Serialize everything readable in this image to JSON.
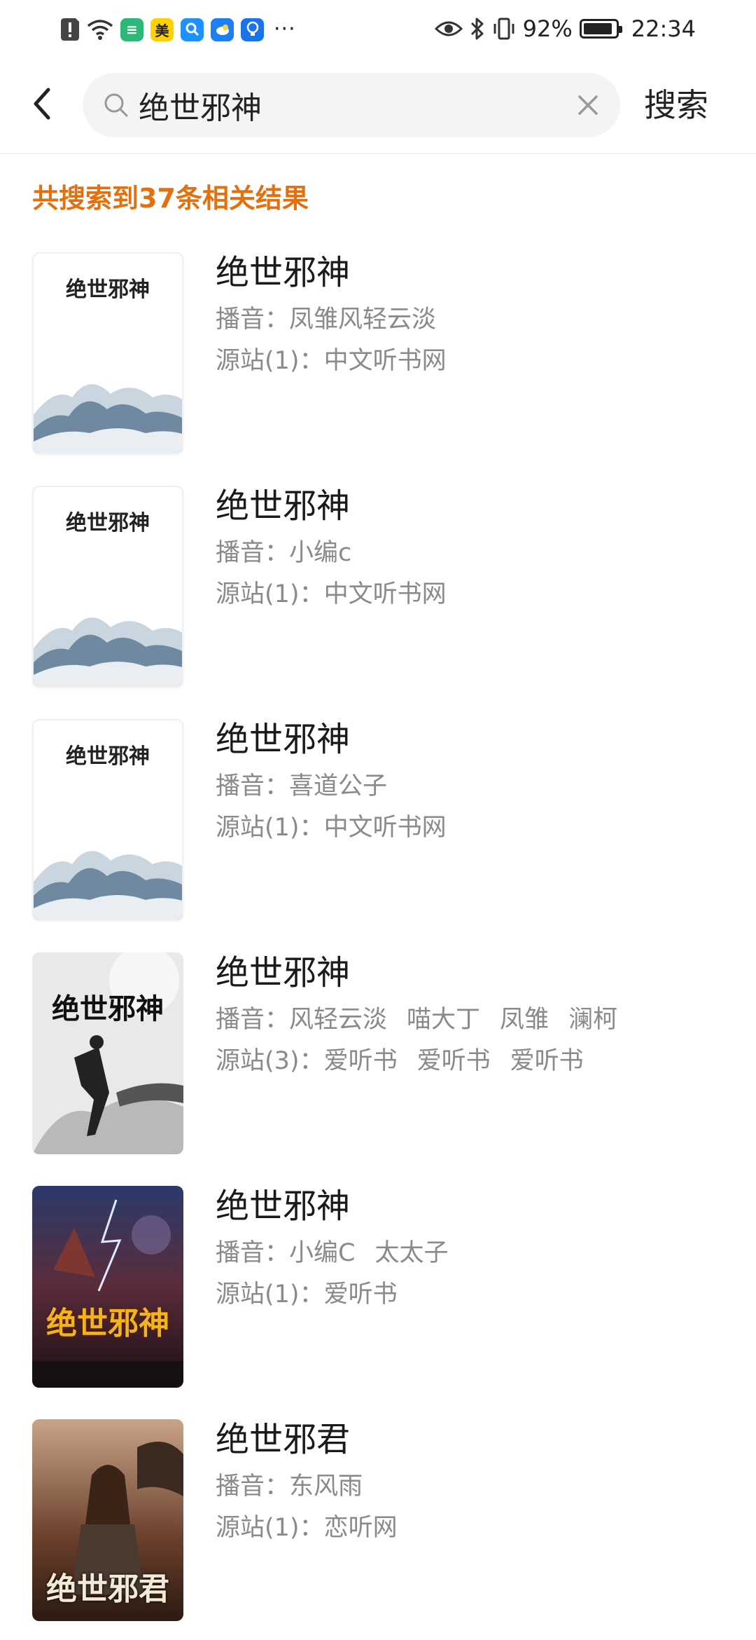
{
  "status_bar": {
    "battery": "92%",
    "battery_level": 0.92,
    "time": "22:34",
    "app_badge_mei": "美",
    "more": "···"
  },
  "header": {
    "search_value": "绝世邪神",
    "search_button": "搜索"
  },
  "result_count": "共搜索到37条相关结果",
  "results": [
    {
      "title": "绝世邪神",
      "narrator_label": "播音：",
      "narrators": [
        "凤雏风轻云淡"
      ],
      "source_label": "源站(1)：",
      "sources": [
        "中文听书网"
      ],
      "cover_style": "default",
      "cover_title": "绝世邪神"
    },
    {
      "title": "绝世邪神",
      "narrator_label": "播音：",
      "narrators": [
        "小编c"
      ],
      "source_label": "源站(1)：",
      "sources": [
        "中文听书网"
      ],
      "cover_style": "default",
      "cover_title": "绝世邪神"
    },
    {
      "title": "绝世邪神",
      "narrator_label": "播音：",
      "narrators": [
        "喜道公子"
      ],
      "source_label": "源站(1)：",
      "sources": [
        "中文听书网"
      ],
      "cover_style": "default",
      "cover_title": "绝世邪神"
    },
    {
      "title": "绝世邪神",
      "narrator_label": "播音：",
      "narrators": [
        "风轻云淡",
        "喵大丁",
        "凤雏",
        "澜柯"
      ],
      "source_label": "源站(3)：",
      "sources": [
        "爱听书",
        "爱听书",
        "爱听书"
      ],
      "cover_style": "ink",
      "cover_title": "绝世邪神"
    },
    {
      "title": "绝世邪神",
      "narrator_label": "播音：",
      "narrators": [
        "小编C",
        "太太子"
      ],
      "source_label": "源站(1)：",
      "sources": [
        "爱听书"
      ],
      "cover_style": "storm",
      "cover_title": "绝世邪神"
    },
    {
      "title": "绝世邪君",
      "narrator_label": "播音：",
      "narrators": [
        "东风雨"
      ],
      "source_label": "源站(1)：",
      "sources": [
        "恋听网"
      ],
      "cover_style": "warrior",
      "cover_title": "绝世邪君"
    }
  ]
}
